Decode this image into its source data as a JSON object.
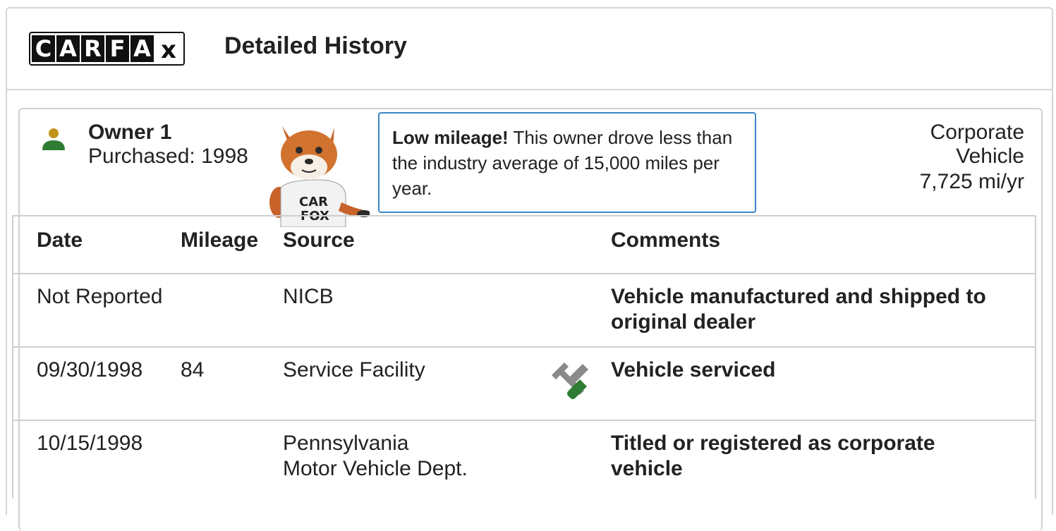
{
  "header": {
    "logo_letters": [
      "C",
      "A",
      "R",
      "F",
      "A"
    ],
    "logo_x": "x",
    "title": "Detailed History"
  },
  "owner": {
    "name": "Owner 1",
    "purchased": "Purchased: 1998",
    "icon": "person-icon",
    "icon_colors": {
      "head": "#c2941a",
      "body": "#2e7d32"
    },
    "mascot": "carfox-mascot",
    "tip_bold": "Low mileage!",
    "tip_text": " This owner drove less than the industry average of 15,000 miles per year.",
    "type_line1": "Corporate",
    "type_line2": "Vehicle",
    "mileage_per_year": "7,725 mi/yr"
  },
  "table": {
    "headers": {
      "date": "Date",
      "mileage": "Mileage",
      "source": "Source",
      "comments": "Comments"
    },
    "rows": [
      {
        "date": "Not Reported",
        "mileage": "",
        "source_line1": "NICB",
        "source_line2": "",
        "comment": "Vehicle manufactured and shipped to original dealer"
      },
      {
        "date": "09/30/1998",
        "mileage": "84",
        "source_line1": "Service Facility",
        "source_line2": "",
        "icon": "wrench-screwdriver-icon",
        "comment": "Vehicle serviced"
      },
      {
        "date": "10/15/1998",
        "mileage": "",
        "source_line1": "Pennsylvania",
        "source_line2": "Motor Vehicle Dept.",
        "comment": "Titled or registered as corporate vehicle"
      }
    ]
  },
  "colors": {
    "accent_border": "#3a86c8",
    "service_icon_green": "#2e7d32",
    "service_icon_gray": "#8a8a8a"
  }
}
